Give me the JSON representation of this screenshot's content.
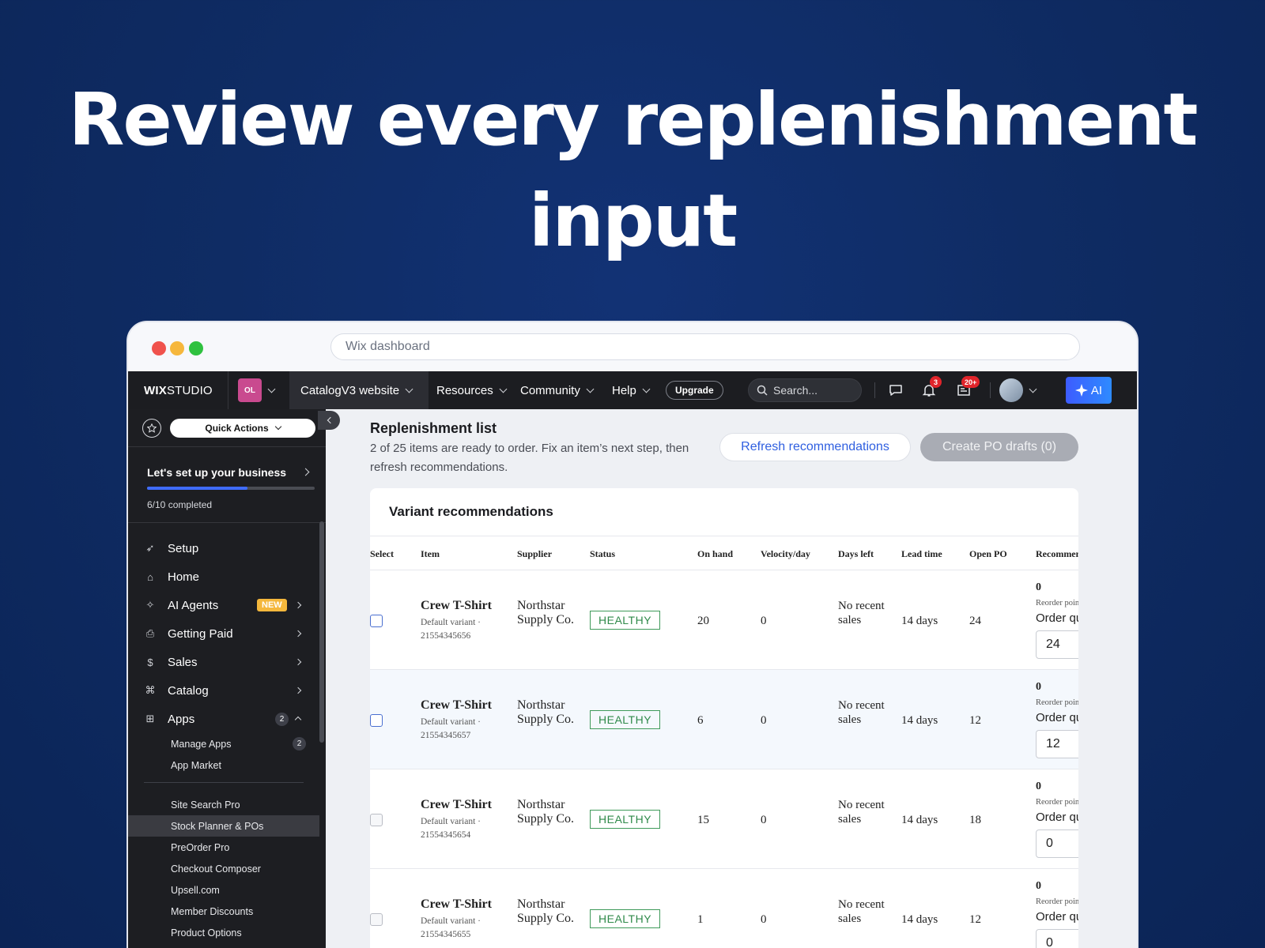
{
  "headline": {
    "line1": "Review every replenishment",
    "line2": "input"
  },
  "browser": {
    "url_placeholder": "Wix dashboard"
  },
  "topbar": {
    "logo_bold": "WIX",
    "logo_light": "STUDIO",
    "workspace_initials": "OL",
    "site_name": "CatalogV3 website",
    "nav": [
      "Resources",
      "Community",
      "Help"
    ],
    "upgrade_label": "Upgrade",
    "search_placeholder": "Search...",
    "notifications_count": "3",
    "inbox_count": "20+",
    "ai_label": "AI",
    "colors": {
      "bar": "#1c1d21",
      "ai_button": "#3d5cff",
      "badge": "#e0242b"
    }
  },
  "sidebar": {
    "quick_actions": "Quick Actions",
    "setup": {
      "title": "Let's set up your business",
      "count_text": "6/10 completed",
      "progress": 0.6
    },
    "items": [
      {
        "label": "Setup",
        "icon": "rocket-icon"
      },
      {
        "label": "Home",
        "icon": "home-icon"
      },
      {
        "label": "AI Agents",
        "icon": "sparkle-icon",
        "badge": "NEW"
      },
      {
        "label": "Getting Paid",
        "icon": "invoice-icon"
      },
      {
        "label": "Sales",
        "icon": "dollar-icon"
      },
      {
        "label": "Catalog",
        "icon": "tag-icon"
      },
      {
        "label": "Apps",
        "icon": "apps-icon",
        "count": "2"
      }
    ],
    "apps_sub": [
      {
        "label": "Manage Apps",
        "count": "2"
      },
      {
        "label": "App Market"
      }
    ],
    "installed_apps": [
      "Site Search Pro",
      "Stock Planner & POs",
      "PreOrder Pro",
      "Checkout Composer",
      "Upsell.com",
      "Member Discounts",
      "Product Options"
    ]
  },
  "main": {
    "title": "Replenishment list",
    "description": "2 of 25 items are ready to order. Fix an item’s next step, then refresh recommendations.",
    "refresh_label": "Refresh recommendations",
    "create_label": "Create PO drafts (0)",
    "card_title": "Variant recommendations",
    "columns": [
      "Select",
      "Item",
      "Supplier",
      "Status",
      "On hand",
      "Velocity/day",
      "Days left",
      "Lead time",
      "Open PO",
      "Recommenda"
    ],
    "rows": [
      {
        "item": "Crew T-Shirt",
        "variant": "Default variant · 21554345656",
        "supplier": "Northstar Supply Co.",
        "status": "HEALTHY",
        "on_hand": "20",
        "velocity": "0",
        "days_left": "No recent sales",
        "lead_time": "14 days",
        "open_po": "24",
        "rec": "0",
        "rec_sub": "Reorder point",
        "order_label": "Order quan",
        "order_qty": "24",
        "selectable": true
      },
      {
        "item": "Crew T-Shirt",
        "variant": "Default variant · 21554345657",
        "supplier": "Northstar Supply Co.",
        "status": "HEALTHY",
        "on_hand": "6",
        "velocity": "0",
        "days_left": "No recent sales",
        "lead_time": "14 days",
        "open_po": "12",
        "rec": "0",
        "rec_sub": "Reorder point",
        "order_label": "Order quan",
        "order_qty": "12",
        "selectable": true
      },
      {
        "item": "Crew T-Shirt",
        "variant": "Default variant · 21554345654",
        "supplier": "Northstar Supply Co.",
        "status": "HEALTHY",
        "on_hand": "15",
        "velocity": "0",
        "days_left": "No recent sales",
        "lead_time": "14 days",
        "open_po": "18",
        "rec": "0",
        "rec_sub": "Reorder point",
        "order_label": "Order quan",
        "order_qty": "0",
        "selectable": false
      },
      {
        "item": "Crew T-Shirt",
        "variant": "Default variant · 21554345655",
        "supplier": "Northstar Supply Co.",
        "status": "HEALTHY",
        "on_hand": "1",
        "velocity": "0",
        "days_left": "No recent sales",
        "lead_time": "14 days",
        "open_po": "12",
        "rec": "0",
        "rec_sub": "Reorder point",
        "order_label": "Order quan",
        "order_qty": "0",
        "selectable": false
      }
    ]
  }
}
